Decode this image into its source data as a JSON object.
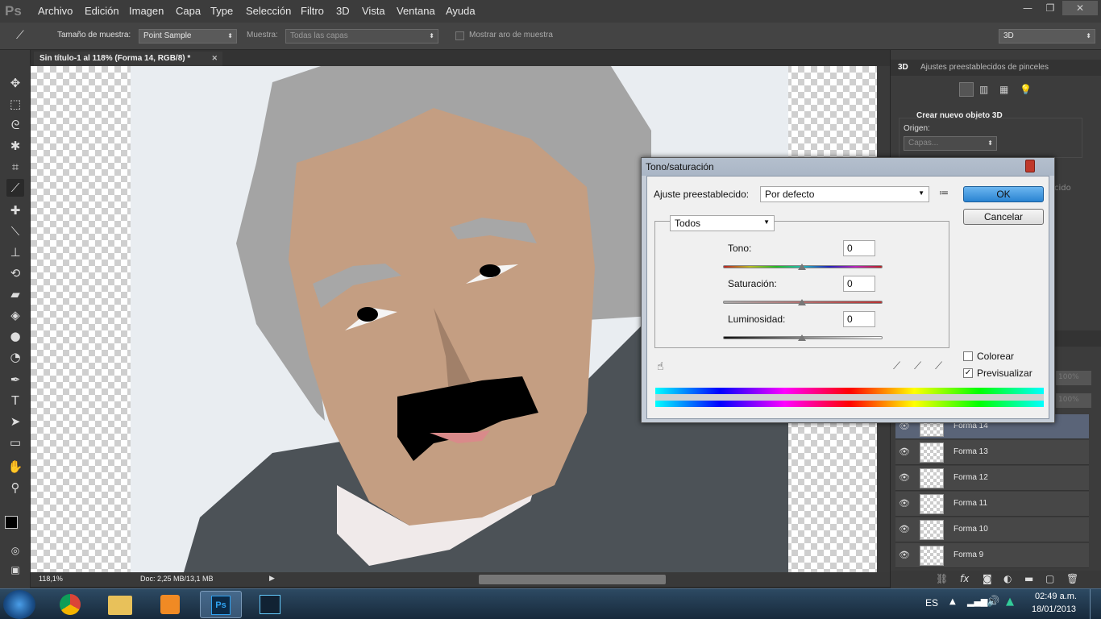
{
  "app": {
    "logo": "Ps",
    "menus": [
      "Archivo",
      "Edición",
      "Imagen",
      "Capa",
      "Type",
      "Selección",
      "Filtro",
      "3D",
      "Vista",
      "Ventana",
      "Ayuda"
    ],
    "window_controls": {
      "minimize": "—",
      "restore": "❐",
      "close": "✕"
    }
  },
  "options_bar": {
    "sample_size_label": "Tamaño de muestra:",
    "sample_size_value": "Point Sample",
    "sample_label": "Muestra:",
    "sample_value": "Todas las capas",
    "show_ring_label": "Mostrar aro de muestra",
    "workspace_value": "3D"
  },
  "document": {
    "tab_title": "Sin título-1 al 118% (Forma 14, RGB/8) *",
    "tab_close": "✕",
    "zoom": "118,1%",
    "doc_info": "Doc: 2,25 MB/13,1 MB"
  },
  "right_panel": {
    "tabs": [
      "3D",
      "Ajustes preestablecidos de pinceles"
    ],
    "section_title": "Crear nuevo objeto 3D",
    "origin_label": "Origen:",
    "origin_value": "Capas...",
    "cut_text": "cido",
    "opacity_value": "100%",
    "fill_value": "100%",
    "layers": [
      {
        "name": "Forma 14",
        "selected": true
      },
      {
        "name": "Forma 13",
        "selected": false
      },
      {
        "name": "Forma 12",
        "selected": false
      },
      {
        "name": "Forma 11",
        "selected": false
      },
      {
        "name": "Forma 10",
        "selected": false
      },
      {
        "name": "Forma 9",
        "selected": false
      }
    ]
  },
  "dialog": {
    "title": "Tono/saturación",
    "preset_label": "Ajuste preestablecido:",
    "preset_value": "Por defecto",
    "ok_label": "OK",
    "cancel_label": "Cancelar",
    "channel_value": "Todos",
    "hue_label": "Tono:",
    "hue_value": "0",
    "saturation_label": "Saturación:",
    "saturation_value": "0",
    "lightness_label": "Luminosidad:",
    "lightness_value": "0",
    "colorize_label": "Colorear",
    "colorize_checked": false,
    "preview_label": "Previsualizar",
    "preview_checked": true
  },
  "taskbar": {
    "language": "ES",
    "time": "02:49 a.m.",
    "date": "18/01/2013",
    "apps": [
      "windows-start",
      "chrome",
      "explorer",
      "media-player",
      "photoshop",
      "remote-app"
    ]
  },
  "colors": {
    "skin": "#c49e82",
    "hair": "#a4a4a4",
    "jacket": "#4c5257",
    "accent_button": "#2a84d2",
    "close_red": "#c0392b",
    "background_red": "#e02020"
  }
}
